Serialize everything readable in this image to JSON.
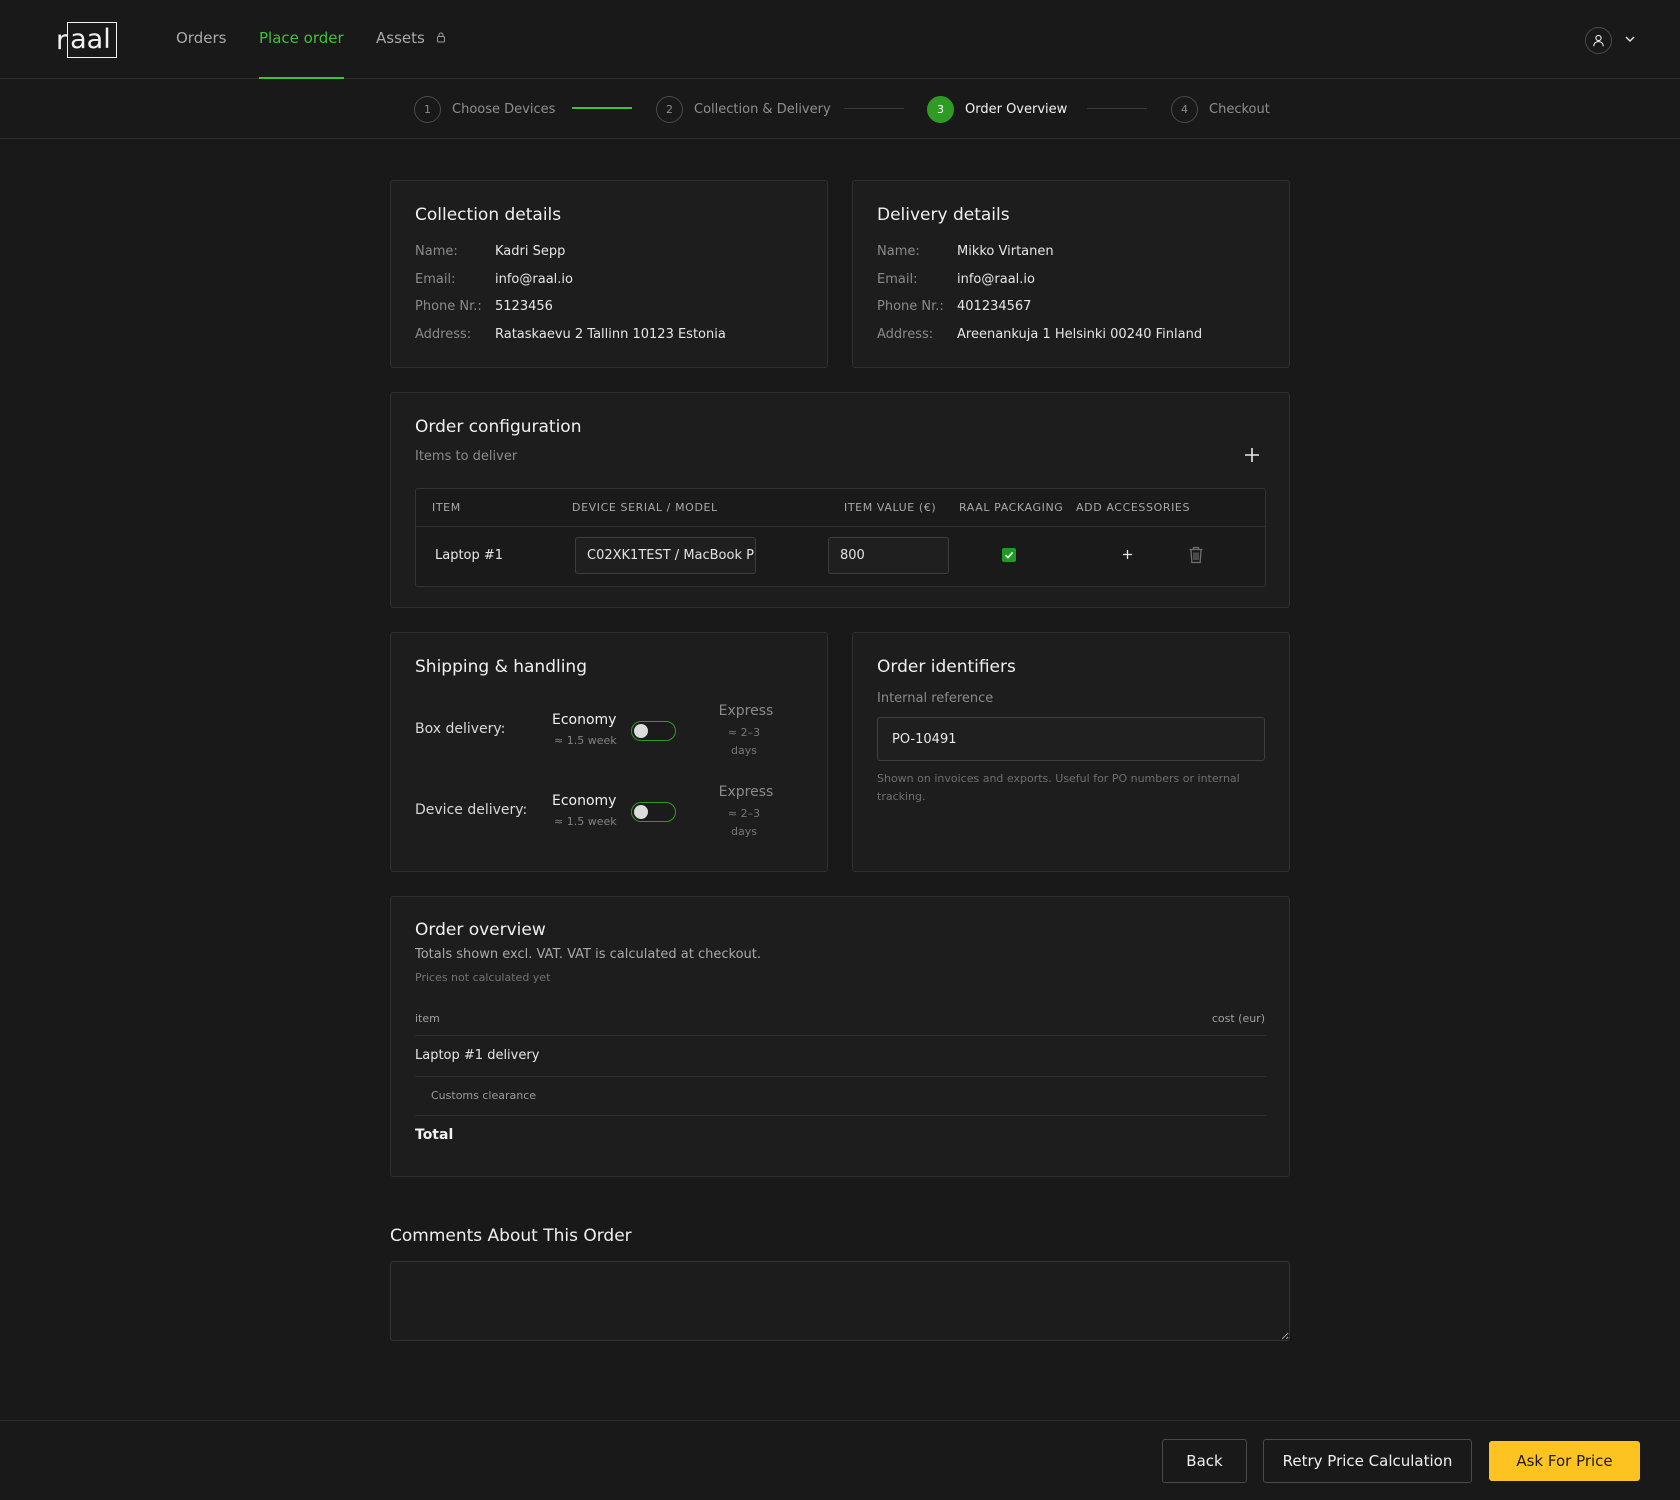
{
  "nav": {
    "logo_plain": "r",
    "logo_boxed": "aal",
    "links": [
      {
        "label": "Orders"
      },
      {
        "label": "Place order"
      },
      {
        "label": "Assets"
      }
    ]
  },
  "stepper": {
    "steps": [
      {
        "num": "1",
        "label": "Choose Devices"
      },
      {
        "num": "2",
        "label": "Collection & Delivery"
      },
      {
        "num": "3",
        "label": "Order Overview"
      },
      {
        "num": "4",
        "label": "Checkout"
      }
    ],
    "active_step": 3
  },
  "collection": {
    "title": "Collection details",
    "name_label": "Name:",
    "name": "Kadri Sepp",
    "email_label": "Email:",
    "email": "info@raal.io",
    "phone_label": "Phone Nr.:",
    "phone": "5123456",
    "address_label": "Address:",
    "address": "Rataskaevu 2 Tallinn 10123 Estonia"
  },
  "delivery": {
    "title": "Delivery details",
    "name_label": "Name:",
    "name": "Mikko Virtanen",
    "email_label": "Email:",
    "email": "info@raal.io",
    "phone_label": "Phone Nr.:",
    "phone": "401234567",
    "address_label": "Address:",
    "address": "Areenankuja 1 Helsinki 00240 Finland"
  },
  "order_config": {
    "title": "Order configuration",
    "subtitle": "Items to deliver",
    "columns": [
      "ITEM",
      "DEVICE SERIAL / MODEL",
      "ITEM VALUE (€)",
      "RAAL PACKAGING",
      "ADD ACCESSORIES"
    ],
    "rows": [
      {
        "item": "Laptop #1",
        "serial_model": "C02XK1TEST / MacBook P",
        "value": "800",
        "raal_packaging": true
      }
    ]
  },
  "shipping": {
    "title": "Shipping & handling",
    "rows": [
      {
        "label": "Box delivery:",
        "economy": "Economy",
        "economy_sub": "≈ 1.5 week",
        "express": "Express",
        "express_sub1": "≈ 2–3",
        "express_sub2": "days",
        "express_selected": false
      },
      {
        "label": "Device delivery:",
        "economy": "Economy",
        "economy_sub": "≈ 1.5 week",
        "express": "Express",
        "express_sub1": "≈ 2–3",
        "express_sub2": "days",
        "express_selected": false
      }
    ]
  },
  "identifiers": {
    "title": "Order identifiers",
    "ref_label": "Internal reference",
    "ref_value": "PO-10491",
    "help": "Shown on invoices and exports. Useful for PO numbers or internal tracking."
  },
  "overview": {
    "title": "Order overview",
    "subtitle": "Totals shown excl. VAT. VAT is calculated at checkout.",
    "note": "Prices not calculated yet",
    "col_item": "item",
    "col_cost": "cost (eur)",
    "rows": [
      {
        "label": "Laptop #1 delivery"
      },
      {
        "label": "Customs clearance"
      }
    ],
    "total_label": "Total"
  },
  "comments": {
    "title": "Comments About This Order",
    "value": ""
  },
  "footer": {
    "back": "Back",
    "retry": "Retry Price Calculation",
    "ask": "Ask For Price"
  },
  "colors": {
    "accent_green": "#3ec13b",
    "step_active": "#2e9b22",
    "primary_button": "#fcc321",
    "background": "#191919"
  }
}
